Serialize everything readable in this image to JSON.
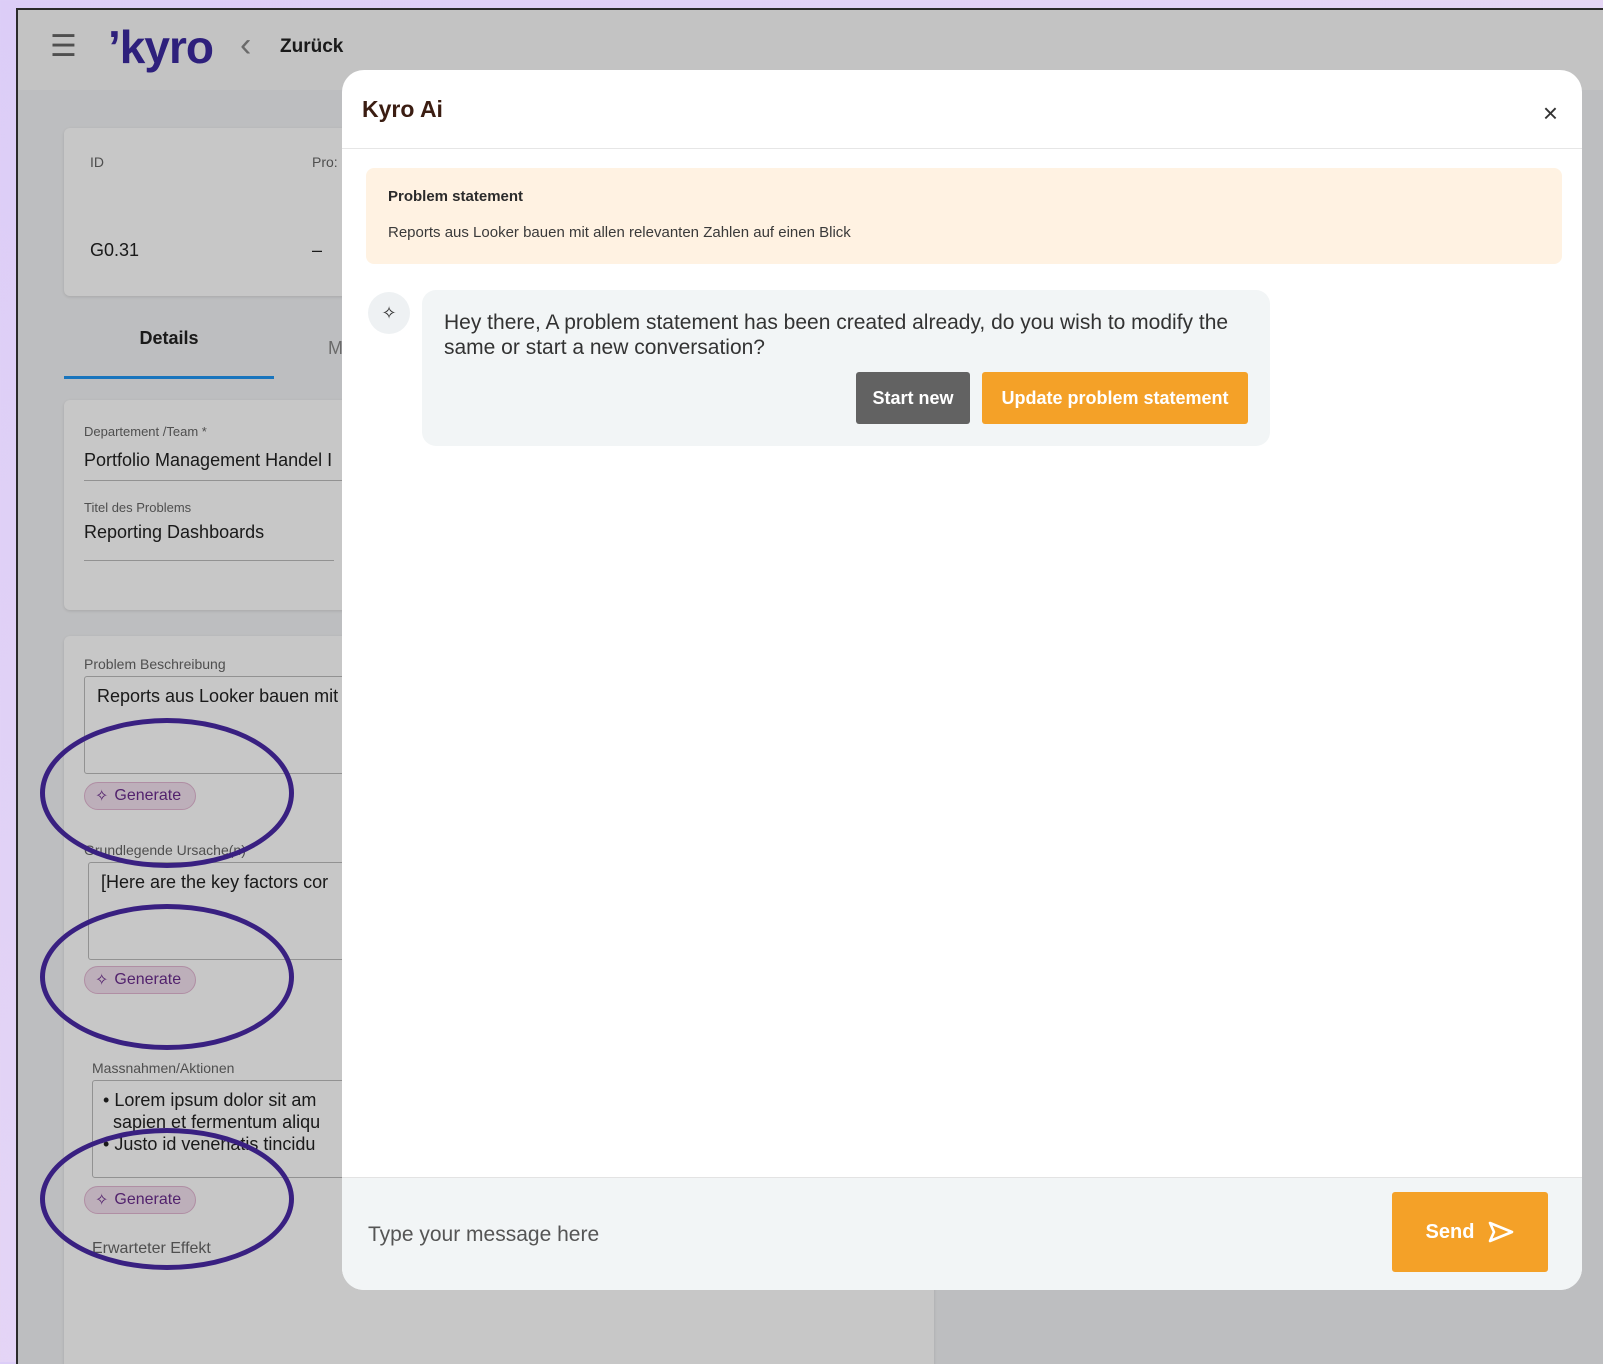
{
  "app": {
    "logo": "ʼkyro",
    "back_label": "Zurück",
    "menu_icon": "hamburger-icon"
  },
  "summary": {
    "id_label": "ID",
    "id_value": "G0.31",
    "col2_label": "Pro:",
    "col2_value": "–"
  },
  "tabs": {
    "details": "Details",
    "other": "M"
  },
  "form": {
    "department_label": "Departement /Team *",
    "department_value": "Portfolio Management Handel I",
    "title_label": "Titel des Problems",
    "title_value": "Reporting Dashboards",
    "problem_label": "Problem Beschreibung",
    "problem_value": "Reports aus Looker bauen mit",
    "causes_label": "Grundlegende Ursache(n)",
    "causes_value": "[Here are the key factors cor",
    "actions_label": "Massnahmen/Aktionen",
    "actions_items": [
      "Lorem ipsum dolor sit am",
      "sapien et fermentum aliqu",
      "Justo id venenatis tincidu"
    ],
    "effect_label": "Erwarteter Effekt",
    "generate_label": "Generate"
  },
  "modal": {
    "title": "Kyro Ai",
    "close": "×",
    "problem_statement": {
      "title": "Problem statement",
      "text": "Reports aus Looker bauen mit allen relevanten Zahlen auf einen Blick"
    },
    "bot_message": "Hey there, A problem statement has been created already, do you wish to modify the same or start a new conversation?",
    "start_new": "Start new",
    "update_statement": "Update problem statement",
    "input_placeholder": "Type your message here",
    "send_label": "Send"
  },
  "colors": {
    "accent_orange": "#f4a128",
    "brand_purple": "#3b2a9f",
    "annotation_ring": "#4a2aa6"
  }
}
